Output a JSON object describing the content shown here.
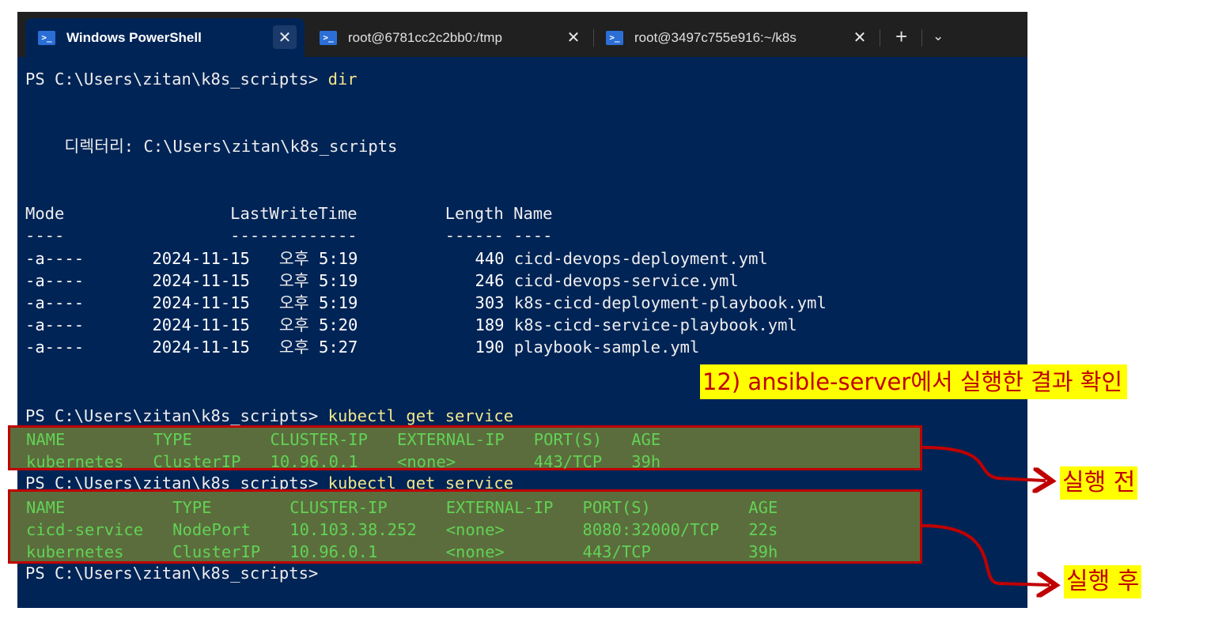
{
  "tabs": [
    {
      "title": "Windows PowerShell",
      "active": true
    },
    {
      "title": "root@6781cc2c2bb0:/tmp",
      "active": false
    },
    {
      "title": "root@3497c755e916:~/k8s",
      "active": false
    }
  ],
  "tab_icon_glyph": ">_",
  "tab_close_glyph": "✕",
  "new_tab_glyph": "+",
  "dropdown_glyph": "⌄",
  "colors": {
    "terminal_bg": "#012456",
    "highlight_border": "#c00000",
    "callout_bg": "#ffff00",
    "callout_text": "#c00000"
  },
  "terminal": {
    "prompt": "PS C:\\Users\\zitan\\k8s_scripts> ",
    "cmd_dir": "dir",
    "directory_line": "    디렉터리: C:\\Users\\zitan\\k8s_scripts",
    "dir_header": "Mode                 LastWriteTime         Length Name",
    "dir_underline": "----                 -------------         ------ ----",
    "dir_rows": [
      {
        "mode": "-a----",
        "date": "2024-11-15",
        "ampm": "오후",
        "time": "5:19",
        "length": "440",
        "name": "cicd-devops-deployment.yml"
      },
      {
        "mode": "-a----",
        "date": "2024-11-15",
        "ampm": "오후",
        "time": "5:19",
        "length": "246",
        "name": "cicd-devops-service.yml"
      },
      {
        "mode": "-a----",
        "date": "2024-11-15",
        "ampm": "오후",
        "time": "5:19",
        "length": "303",
        "name": "k8s-cicd-deployment-playbook.yml"
      },
      {
        "mode": "-a----",
        "date": "2024-11-15",
        "ampm": "오후",
        "time": "5:20",
        "length": "189",
        "name": "k8s-cicd-service-playbook.yml"
      },
      {
        "mode": "-a----",
        "date": "2024-11-15",
        "ampm": "오후",
        "time": "5:27",
        "length": "190",
        "name": "playbook-sample.yml"
      }
    ],
    "cmd_kubectl": "kubectl get service",
    "svc_before": {
      "header": "NAME         TYPE        CLUSTER-IP   EXTERNAL-IP   PORT(S)   AGE",
      "rows": [
        "kubernetes   ClusterIP   10.96.0.1    <none>        443/TCP   39h"
      ]
    },
    "svc_after": {
      "header": "NAME           TYPE        CLUSTER-IP      EXTERNAL-IP   PORT(S)          AGE",
      "rows": [
        "cicd-service   NodePort    10.103.38.252   <none>        8080:32000/TCP   22s",
        "kubernetes     ClusterIP   10.96.0.1       <none>        443/TCP          39h"
      ]
    }
  },
  "annotations": {
    "title": "12) ansible-server에서 실행한 결과 확인",
    "before": "실행 전",
    "after": "실행 후"
  }
}
